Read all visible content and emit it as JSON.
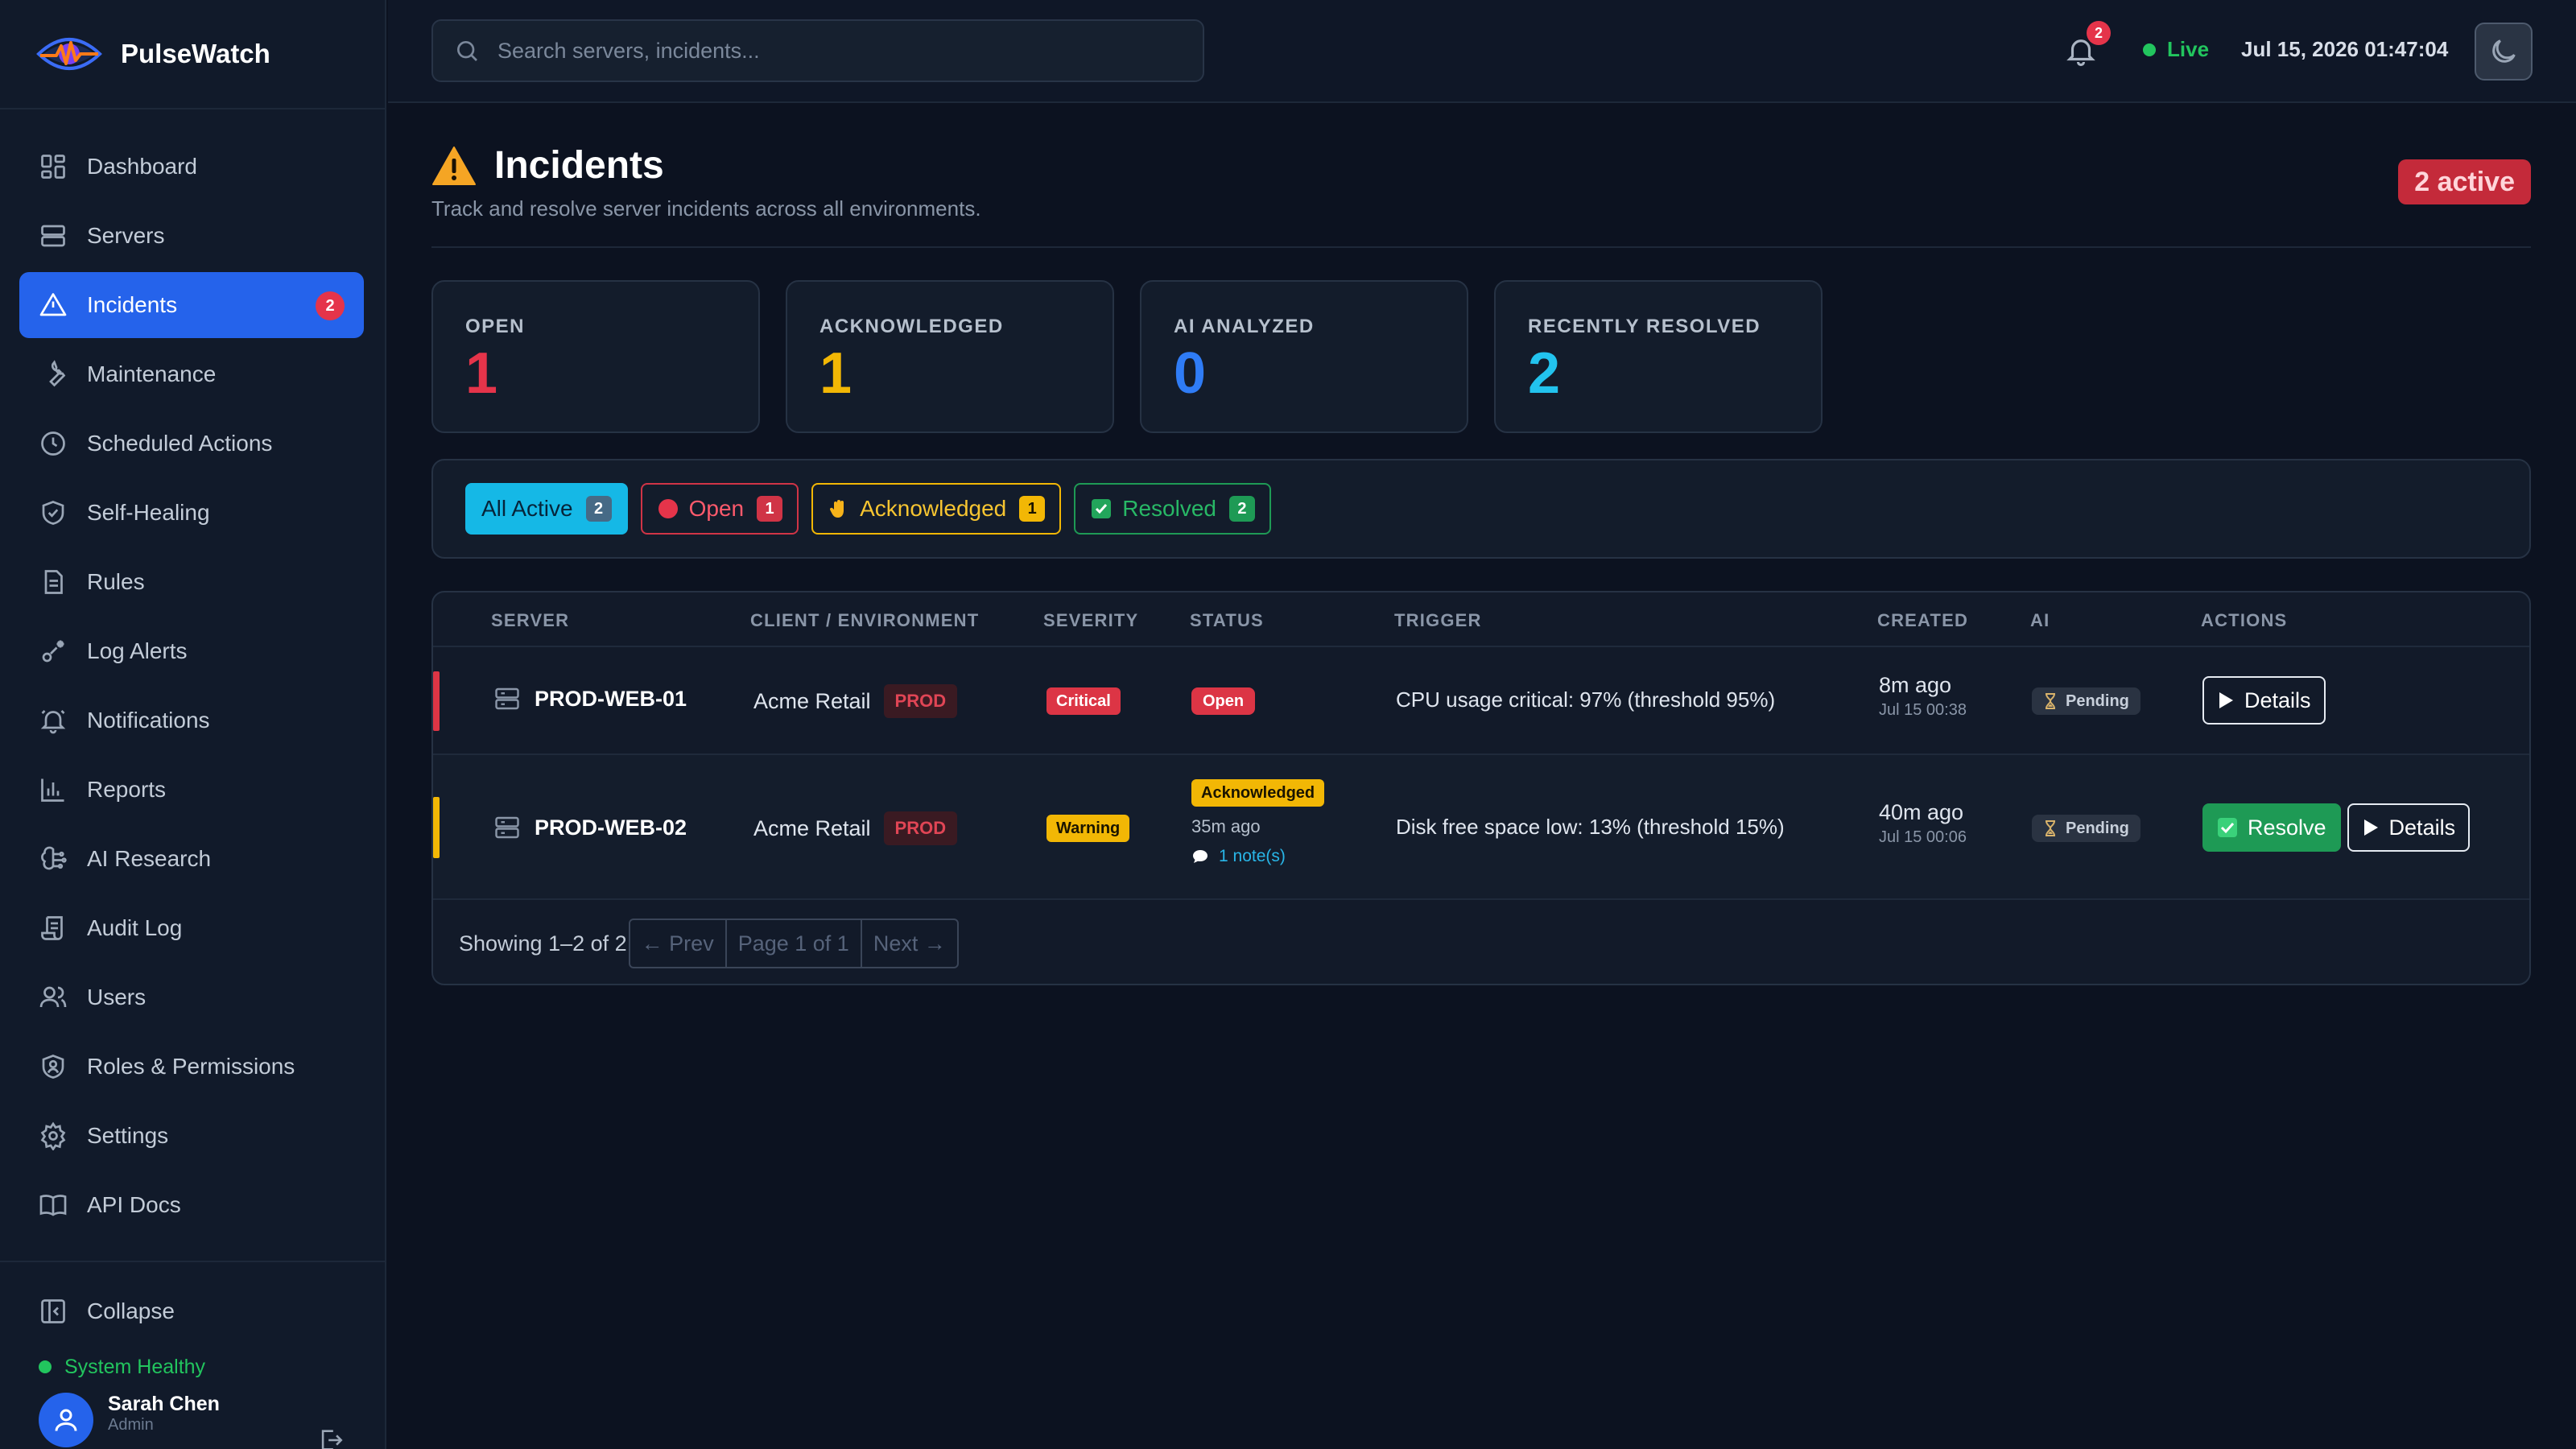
{
  "app": {
    "name": "PulseWatch"
  },
  "sidebar": {
    "items": [
      {
        "label": "Dashboard",
        "icon": "dashboard-icon"
      },
      {
        "label": "Servers",
        "icon": "server-icon"
      },
      {
        "label": "Incidents",
        "icon": "warning-icon",
        "badge": "2",
        "active": true
      },
      {
        "label": "Maintenance",
        "icon": "wrench-icon"
      },
      {
        "label": "Scheduled Actions",
        "icon": "clock-icon"
      },
      {
        "label": "Self-Healing",
        "icon": "shield-check-icon"
      },
      {
        "label": "Rules",
        "icon": "document-icon"
      },
      {
        "label": "Log Alerts",
        "icon": "log-alert-icon"
      },
      {
        "label": "Notifications",
        "icon": "bell-icon"
      },
      {
        "label": "Reports",
        "icon": "bar-chart-icon"
      },
      {
        "label": "AI Research",
        "icon": "brain-icon"
      },
      {
        "label": "Audit Log",
        "icon": "scroll-icon"
      },
      {
        "label": "Users",
        "icon": "users-icon"
      },
      {
        "label": "Roles & Permissions",
        "icon": "shield-user-icon"
      },
      {
        "label": "Settings",
        "icon": "gear-icon"
      },
      {
        "label": "API Docs",
        "icon": "book-icon"
      }
    ],
    "collapse_label": "Collapse",
    "health_label": "System Healthy",
    "user": {
      "name": "Sarah Chen",
      "role": "Admin"
    }
  },
  "topbar": {
    "search_placeholder": "Search servers, incidents...",
    "notification_count": "2",
    "live_label": "Live",
    "datetime": "Jul 15, 2026 01:47:04"
  },
  "page": {
    "title": "Incidents",
    "subtitle": "Track and resolve server incidents across all environments.",
    "active_badge": "2 active"
  },
  "stats": [
    {
      "label": "OPEN",
      "value": "1",
      "color": "#e5344a"
    },
    {
      "label": "ACKNOWLEDGED",
      "value": "1",
      "color": "#f2b705"
    },
    {
      "label": "AI ANALYZED",
      "value": "0",
      "color": "#2f7cf6"
    },
    {
      "label": "RECENTLY RESOLVED",
      "value": "2",
      "color": "#22c3ee"
    }
  ],
  "filters": [
    {
      "label": "All Active",
      "count": "2"
    },
    {
      "label": "Open",
      "count": "1"
    },
    {
      "label": "Acknowledged",
      "count": "1"
    },
    {
      "label": "Resolved",
      "count": "2"
    }
  ],
  "table": {
    "headers": [
      "SERVER",
      "CLIENT / ENVIRONMENT",
      "SEVERITY",
      "STATUS",
      "TRIGGER",
      "CREATED",
      "AI",
      "ACTIONS"
    ],
    "rows": [
      {
        "server": "PROD-WEB-01",
        "client": "Acme Retail",
        "env": "PROD",
        "severity": "Critical",
        "status": "Open",
        "trigger": "CPU usage critical: 97% (threshold 95%)",
        "created": "8m ago",
        "created_at": "Jul 15 00:38",
        "ai": "Pending",
        "details_label": "Details"
      },
      {
        "server": "PROD-WEB-02",
        "client": "Acme Retail",
        "env": "PROD",
        "severity": "Warning",
        "status": "Acknowledged",
        "status_time": "35m ago",
        "notes": "1 note(s)",
        "trigger": "Disk free space low: 13% (threshold 15%)",
        "created": "40m ago",
        "created_at": "Jul 15 00:06",
        "ai": "Pending",
        "resolve_label": "Resolve",
        "details_label": "Details"
      }
    ]
  },
  "pagination": {
    "showing": "Showing 1–2 of 2",
    "prev": "← Prev",
    "page": "Page 1 of 1",
    "next": "Next →"
  },
  "colors": {
    "accent": "#2563eb",
    "critical": "#dc3545",
    "warning": "#f2b705",
    "success": "#1e9a55",
    "info": "#15b8e6"
  }
}
